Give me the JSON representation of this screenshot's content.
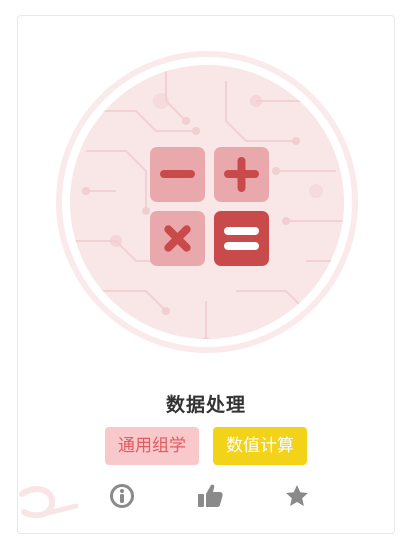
{
  "card": {
    "title": "数据处理",
    "tags": [
      {
        "label": "通用组学",
        "color": "#f9c8ca",
        "text_color": "#e25a60"
      },
      {
        "label": "数值计算",
        "color": "#f2d31a",
        "text_color": "#ffffff"
      }
    ],
    "actions": [
      {
        "icon": "info-icon"
      },
      {
        "icon": "thumbs-up-icon"
      },
      {
        "icon": "star-icon"
      }
    ],
    "hero_icon": "calculator-icon",
    "accent_colors": {
      "primary": "#c94a4a",
      "light": "#e9a9ac",
      "circle_bg": "#f9e6e7",
      "action_gray": "#8a8a8a"
    }
  }
}
